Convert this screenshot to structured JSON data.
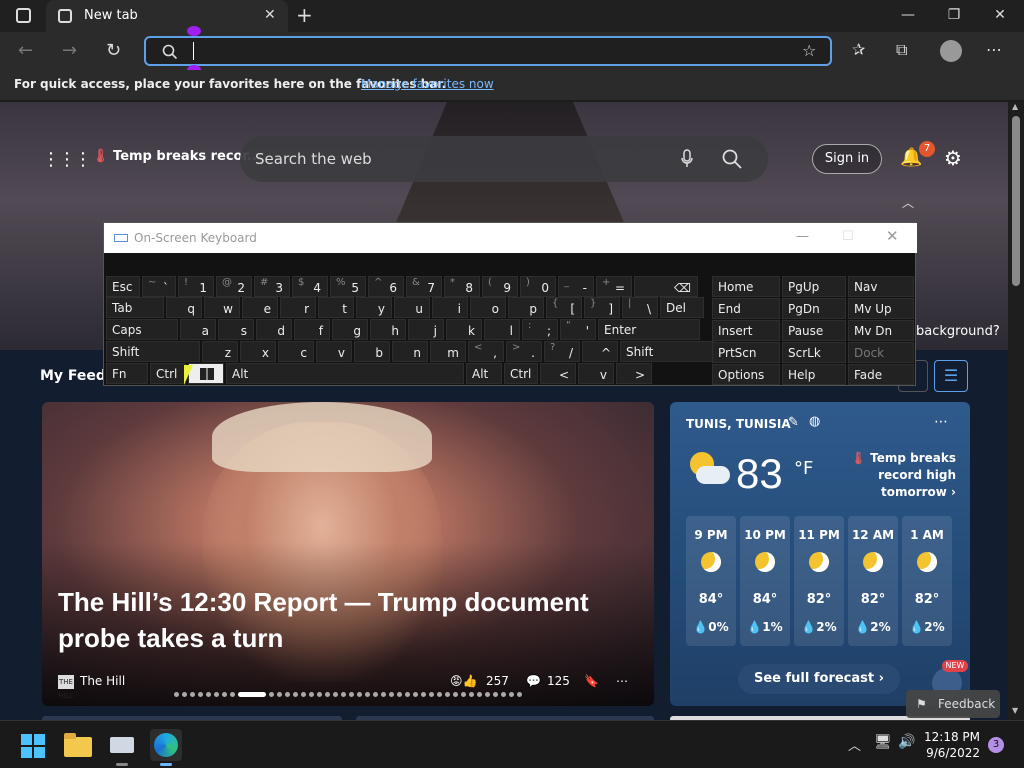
{
  "browser": {
    "tab_title": "New tab",
    "favorites_message": "For quick access, place your favorites here on the favorites bar.",
    "favorites_link": "Manage favorites now"
  },
  "newtab": {
    "temp_alert": "Temp breaks recor...",
    "search_placeholder": "Search the web",
    "sign_in": "Sign in",
    "notification_count": "7",
    "background_question": "background?",
    "my_feed": "My Feed"
  },
  "news": {
    "headline": "The Hill’s 12:30 Report — Trump document probe takes a turn",
    "source": "The Hill",
    "source_logo": "THE HILL",
    "reactions": "257",
    "comments": "125"
  },
  "weather": {
    "location": "TUNIS, TUNISIA",
    "temperature": "83",
    "unit": "°F",
    "alert": "Temp breaks record high tomorrow",
    "hours": [
      {
        "time": "9 PM",
        "temp": "84°",
        "rain": "0%"
      },
      {
        "time": "10 PM",
        "temp": "84°",
        "rain": "1%"
      },
      {
        "time": "11 PM",
        "temp": "82°",
        "rain": "2%"
      },
      {
        "time": "12 AM",
        "temp": "82°",
        "rain": "2%"
      },
      {
        "time": "1 AM",
        "temp": "82°",
        "rain": "2%"
      }
    ],
    "forecast_button": "See full forecast",
    "new_badge": "NEW"
  },
  "feedback": "Feedback",
  "keyboard": {
    "title": "On-Screen Keyboard",
    "row1": [
      [
        "Esc",
        ""
      ],
      [
        "~",
        "`"
      ],
      [
        "!",
        "1"
      ],
      [
        "@",
        "2"
      ],
      [
        "#",
        "3"
      ],
      [
        "$",
        "4"
      ],
      [
        "%",
        "5"
      ],
      [
        "^",
        "6"
      ],
      [
        "&",
        "7"
      ],
      [
        "*",
        "8"
      ],
      [
        "(",
        "9"
      ],
      [
        ")",
        "0"
      ],
      [
        "_",
        "-"
      ],
      [
        "+",
        "="
      ],
      [
        "",
        "⌫"
      ]
    ],
    "row2": [
      [
        "Tab",
        ""
      ],
      [
        "",
        "q"
      ],
      [
        "",
        "w"
      ],
      [
        "",
        "e"
      ],
      [
        "",
        "r"
      ],
      [
        "",
        "t"
      ],
      [
        "",
        "y"
      ],
      [
        "",
        "u"
      ],
      [
        "",
        "i"
      ],
      [
        "",
        "o"
      ],
      [
        "",
        "p"
      ],
      [
        "{",
        "["
      ],
      [
        "}",
        "]"
      ],
      [
        "|",
        "\\"
      ],
      [
        "Del",
        ""
      ]
    ],
    "row3": [
      [
        "Caps",
        ""
      ],
      [
        "",
        "a"
      ],
      [
        "",
        "s"
      ],
      [
        "",
        "d"
      ],
      [
        "",
        "f"
      ],
      [
        "",
        "g"
      ],
      [
        "",
        "h"
      ],
      [
        "",
        "j"
      ],
      [
        "",
        "k"
      ],
      [
        "",
        "l"
      ],
      [
        ":",
        ";"
      ],
      [
        "\"",
        "'"
      ],
      [
        "Enter",
        ""
      ]
    ],
    "row4": [
      [
        "Shift",
        ""
      ],
      [
        "",
        "z"
      ],
      [
        "",
        "x"
      ],
      [
        "",
        "c"
      ],
      [
        "",
        "v"
      ],
      [
        "",
        "b"
      ],
      [
        "",
        "n"
      ],
      [
        "",
        "m"
      ],
      [
        "<",
        ","
      ],
      [
        ">",
        "."
      ],
      [
        "?",
        "/"
      ],
      [
        "",
        "^"
      ],
      [
        "Shift",
        ""
      ]
    ],
    "row5": [
      [
        "Fn",
        ""
      ],
      [
        "Ctrl",
        ""
      ],
      [
        "",
        ""
      ],
      [
        "Alt",
        ""
      ],
      [
        "Alt",
        ""
      ],
      [
        "Ctrl",
        ""
      ],
      [
        "",
        "<"
      ],
      [
        "",
        "v"
      ],
      [
        "",
        ">"
      ]
    ],
    "nav": [
      [
        "Home",
        "PgUp",
        "Nav"
      ],
      [
        "End",
        "PgDn",
        "Mv Up"
      ],
      [
        "Insert",
        "Pause",
        "Mv Dn"
      ],
      [
        "PrtScn",
        "ScrLk",
        "Dock"
      ],
      [
        "Options",
        "Help",
        "Fade"
      ]
    ]
  },
  "taskbar": {
    "time": "12:18 PM",
    "date": "9/6/2022",
    "notifications": "3"
  }
}
